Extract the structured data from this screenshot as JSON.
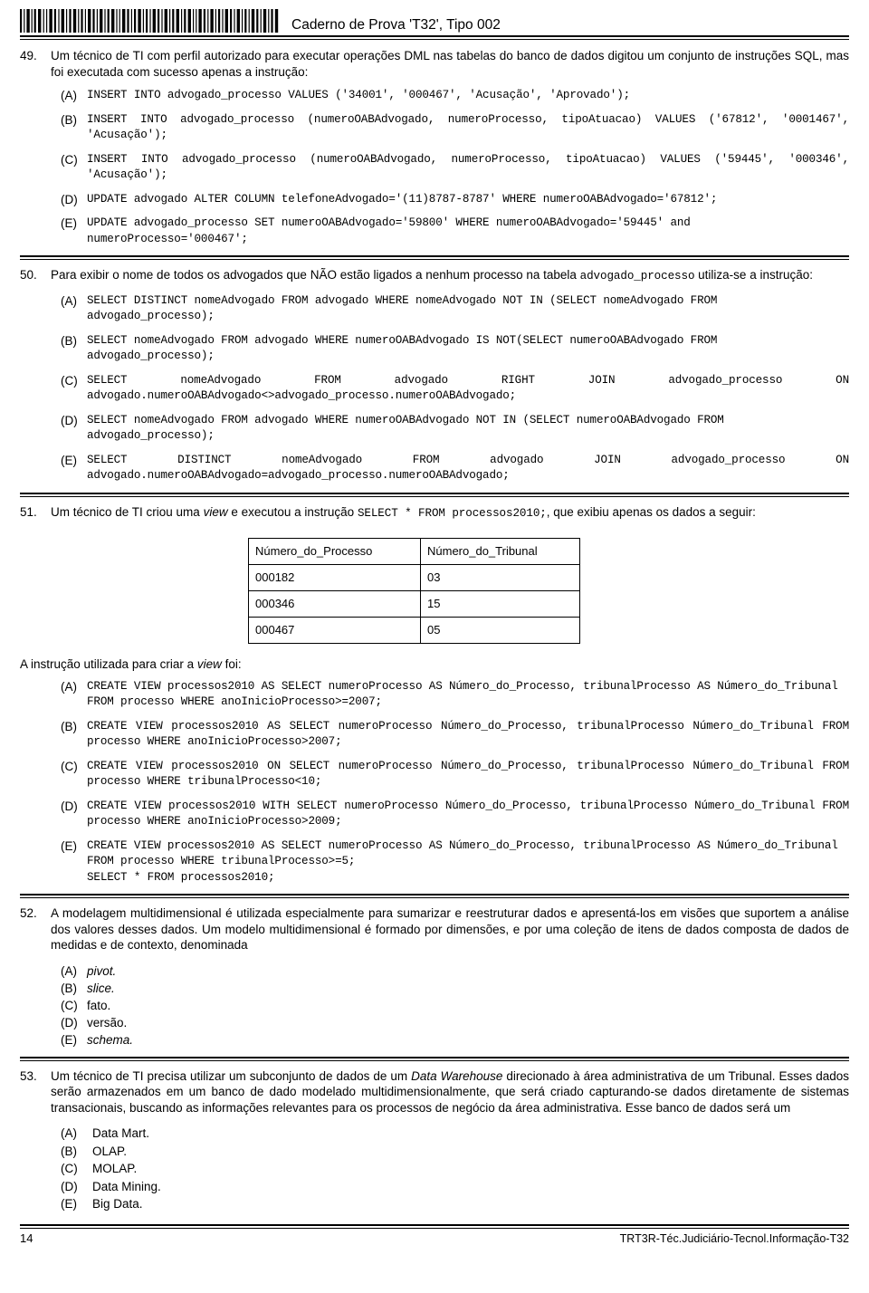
{
  "header": {
    "title": "Caderno de Prova 'T32', Tipo 002",
    "barcode_name": "barcode"
  },
  "questions": [
    {
      "number": "49.",
      "stem_parts": [
        {
          "t": "Um técnico de TI com perfil autorizado para executar operações DML nas tabelas do banco de dados digitou um conjunto de instruções SQL, mas foi executada com sucesso apenas a instrução:",
          "style": "normal"
        }
      ],
      "options": [
        {
          "label": "(A)",
          "text": "INSERT INTO advogado_processo VALUES ('34001', '000467', 'Acusação', 'Aprovado');",
          "style": "code"
        },
        {
          "label": "(B)",
          "text": "INSERT INTO advogado_processo (numeroOABAdvogado, numeroProcesso, tipoAtuacao) VALUES ('67812', '0001467', 'Acusação');",
          "style": "code-just"
        },
        {
          "label": "(C)",
          "text": "INSERT INTO advogado_processo (numeroOABAdvogado, numeroProcesso, tipoAtuacao) VALUES ('59445', '000346', 'Acusação');",
          "style": "code-just"
        },
        {
          "label": "(D)",
          "text": "UPDATE advogado ALTER COLUMN telefoneAdvogado='(11)8787-8787' WHERE numeroOABAdvogado='67812';",
          "style": "code"
        },
        {
          "label": "(E)",
          "text": "UPDATE advogado_processo SET numeroOABAdvogado='59800' WHERE numeroOABAdvogado='59445' and numeroProcesso='000467';",
          "style": "code"
        }
      ]
    },
    {
      "number": "50.",
      "stem_html": "Para exibir o nome de todos os advogados que NÃO estão ligados a nenhum processo na tabela <span class=\"mono\">advogado_processo</span> utiliza-se a instrução:",
      "options": [
        {
          "label": "(A)",
          "text": "SELECT DISTINCT nomeAdvogado FROM advogado WHERE nomeAdvogado NOT IN (SELECT nomeAdvogado FROM advogado_processo);",
          "style": "code"
        },
        {
          "label": "(B)",
          "text": "SELECT nomeAdvogado FROM advogado WHERE numeroOABAdvogado IS NOT(SELECT numeroOABAdvogado FROM advogado_processo);",
          "style": "code"
        },
        {
          "label": "(C)",
          "text": "SELECT nomeAdvogado FROM advogado RIGHT JOIN advogado_processo ON advogado.numeroOABAdvogado<>advogado_processo.numeroOABAdvogado;",
          "style": "code-just"
        },
        {
          "label": "(D)",
          "text": "SELECT nomeAdvogado FROM advogado WHERE numeroOABAdvogado NOT IN (SELECT numeroOABAdvogado FROM advogado_processo);",
          "style": "code"
        },
        {
          "label": "(E)",
          "text": "SELECT DISTINCT nomeAdvogado FROM advogado JOIN advogado_processo ON advogado.numeroOABAdvogado=advogado_processo.numeroOABAdvogado;",
          "style": "code-just"
        }
      ]
    },
    {
      "number": "51.",
      "stem_html": "Um técnico de TI criou uma <span class=\"ital\">view</span> e executou a instrução <span class=\"mono\">SELECT * FROM processos2010;</span>, que exibiu apenas os dados a seguir:",
      "table": {
        "columns": [
          "Número_do_Processo",
          "Número_do_Tribunal"
        ],
        "rows": [
          [
            "000182",
            "03"
          ],
          [
            "000346",
            "15"
          ],
          [
            "000467",
            "05"
          ]
        ]
      },
      "after_table_html": "A instrução utilizada para criar a <span class=\"ital\">view</span> foi:",
      "options": [
        {
          "label": "(A)",
          "text": "CREATE VIEW processos2010 AS SELECT numeroProcesso AS Número_do_Processo, tribunalProcesso AS Número_do_Tribunal FROM processo WHERE anoInicioProcesso>=2007;",
          "style": "code"
        },
        {
          "label": "(B)",
          "text": "CREATE VIEW processos2010 AS SELECT numeroProcesso Número_do_Processo, tribunalProcesso Número_do_Tribunal FROM processo WHERE anoInicioProcesso>2007;",
          "style": "code-just"
        },
        {
          "label": "(C)",
          "text": "CREATE VIEW processos2010 ON SELECT numeroProcesso Número_do_Processo, tribunalProcesso Número_do_Tribunal FROM processo WHERE tribunalProcesso<10;",
          "style": "code-just"
        },
        {
          "label": "(D)",
          "text": "CREATE VIEW processos2010 WITH SELECT numeroProcesso Número_do_Processo, tribunalProcesso Número_do_Tribunal FROM processo WHERE anoInicioProcesso>2009;",
          "style": "code-just"
        },
        {
          "label": "(E)",
          "text": "CREATE VIEW processos2010 AS SELECT numeroProcesso AS Número_do_Processo, tribunalProcesso AS Número_do_Tribunal FROM processo WHERE tribunalProcesso>=5;\nSELECT * FROM processos2010;",
          "style": "code"
        }
      ]
    },
    {
      "number": "52.",
      "stem_html": "A modelagem multidimensional é utilizada especialmente para sumarizar e reestruturar dados e apresentá-los em visões que suportem a análise dos valores desses dados. Um modelo multidimensional é formado por dimensões, e por uma coleção de itens de dados composta de dados de medidas e de contexto, denominada",
      "options": [
        {
          "label": "(A)",
          "text": "pivot.",
          "style": "italic"
        },
        {
          "label": "(B)",
          "text": "slice.",
          "style": "italic"
        },
        {
          "label": "(C)",
          "text": "fato.",
          "style": "normal"
        },
        {
          "label": "(D)",
          "text": "versão.",
          "style": "normal"
        },
        {
          "label": "(E)",
          "text": "schema.",
          "style": "italic"
        }
      ]
    },
    {
      "number": "53.",
      "stem_html": "Um técnico de TI precisa utilizar um subconjunto de dados de um <span class=\"ital\">Data Warehouse</span> direcionado à área administrativa de um Tribunal. Esses dados serão armazenados em um banco de dado modelado multidimensionalmente, que será criado capturando-se dados diretamente de sistemas transacionais, buscando as informações relevantes para os processos de negócio da área administrativa. Esse banco de dados será um",
      "options": [
        {
          "label": "(A)",
          "text": "Data Mart.",
          "style": "normal"
        },
        {
          "label": "(B)",
          "text": "OLAP.",
          "style": "normal"
        },
        {
          "label": "(C)",
          "text": "MOLAP.",
          "style": "normal"
        },
        {
          "label": "(D)",
          "text": "Data Mining.",
          "style": "normal"
        },
        {
          "label": "(E)",
          "text": "Big Data.",
          "style": "normal"
        }
      ]
    }
  ],
  "footer": {
    "page_number": "14",
    "doc_code": "TRT3R-Téc.Judiciário-Tecnol.Informação-T32"
  }
}
